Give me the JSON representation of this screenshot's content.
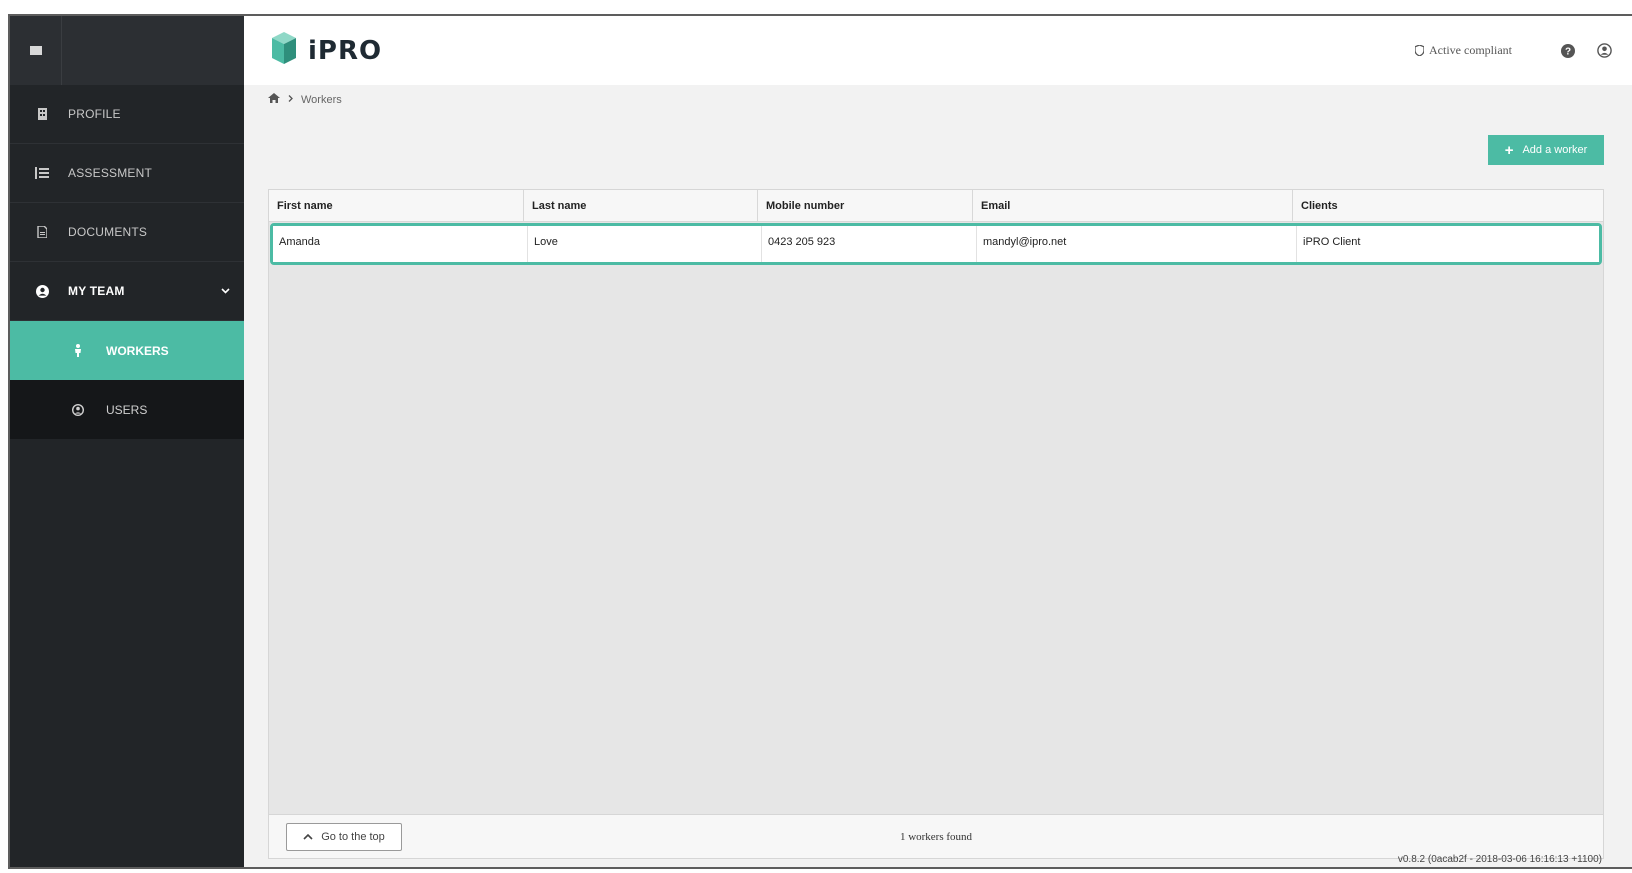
{
  "app": {
    "logo_text": "iPRO",
    "accent_color": "#4cbba4"
  },
  "sidebar": {
    "items": [
      {
        "label": "PROFILE",
        "icon": "building-icon"
      },
      {
        "label": "ASSESSMENT",
        "icon": "list-icon"
      },
      {
        "label": "DOCUMENTS",
        "icon": "document-icon"
      },
      {
        "label": "MY TEAM",
        "icon": "user-circle-icon"
      }
    ],
    "sub_items": [
      {
        "label": "WORKERS",
        "icon": "worker-icon",
        "active": true
      },
      {
        "label": "USERS",
        "icon": "user-icon",
        "active": false
      }
    ]
  },
  "header": {
    "compliance_label": "Active compliant",
    "icons": [
      "shield-icon",
      "help-icon",
      "account-icon"
    ]
  },
  "breadcrumb": {
    "current": "Workers"
  },
  "toolbar": {
    "add_label": "Add a worker"
  },
  "table": {
    "columns": [
      "First name",
      "Last name",
      "Mobile number",
      "Email",
      "Clients"
    ],
    "rows": [
      [
        "Amanda",
        "Love",
        "0423 205 923",
        "mandyl@ipro.net",
        "iPRO Client"
      ]
    ]
  },
  "footer": {
    "top_label": "Go to the top",
    "count_label": "1 workers found",
    "version": "v0.8.2 (0acab2f - 2018-03-06 16:16:13 +1100)"
  }
}
